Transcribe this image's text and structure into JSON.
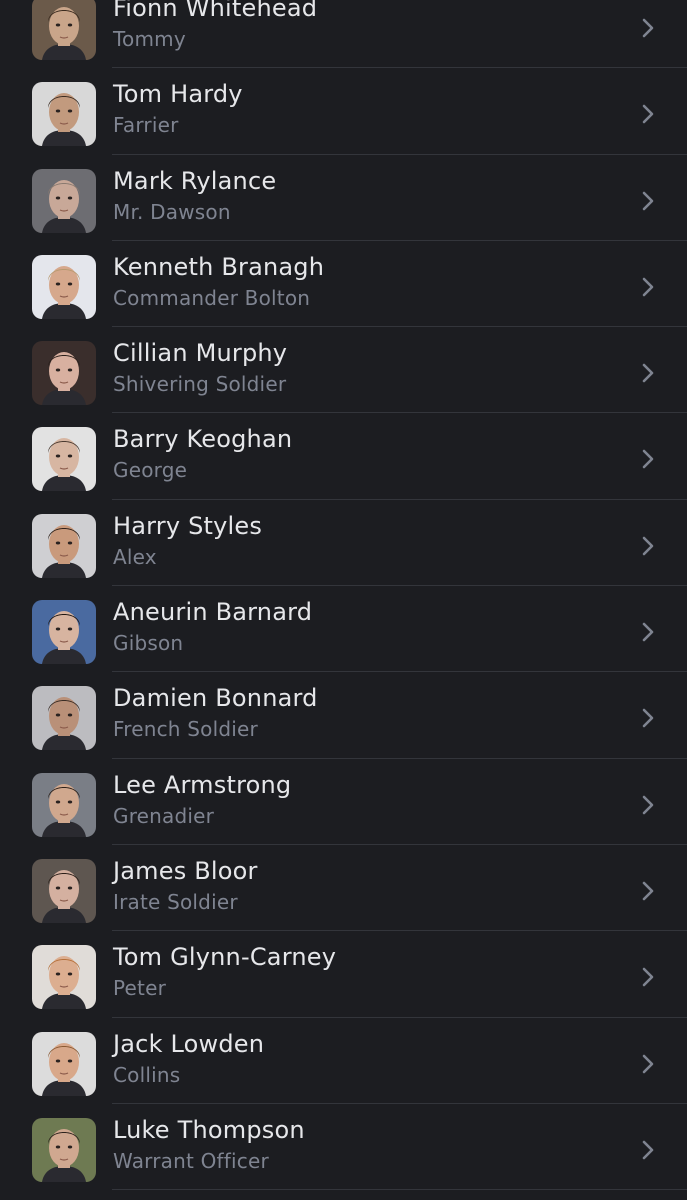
{
  "cast": [
    {
      "actor": "Fionn Whitehead",
      "character": "Tommy",
      "skin": "#c9a58a",
      "hair": "#3a2a1e",
      "bg": "#6b5a4a"
    },
    {
      "actor": "Tom Hardy",
      "character": "Farrier",
      "skin": "#c29a7e",
      "hair": "#3b2c22",
      "bg": "#d8d8d8"
    },
    {
      "actor": "Mark Rylance",
      "character": "Mr. Dawson",
      "skin": "#c8a898",
      "hair": "#8a7a70",
      "bg": "#6d6d72"
    },
    {
      "actor": "Kenneth Branagh",
      "character": "Commander Bolton",
      "skin": "#d6a88c",
      "hair": "#b89a70",
      "bg": "#e4e6ec"
    },
    {
      "actor": "Cillian Murphy",
      "character": "Shivering Soldier",
      "skin": "#d8b0a0",
      "hair": "#2a1f1a",
      "bg": "#3a2e2c"
    },
    {
      "actor": "Barry Keoghan",
      "character": "George",
      "skin": "#d7b6a2",
      "hair": "#4a3a30",
      "bg": "#e2e2e2"
    },
    {
      "actor": "Harry Styles",
      "character": "Alex",
      "skin": "#c99a7c",
      "hair": "#2e2018",
      "bg": "#cfcfd2"
    },
    {
      "actor": "Aneurin Barnard",
      "character": "Gibson",
      "skin": "#d7b4a0",
      "hair": "#1e1612",
      "bg": "#4a6aa0"
    },
    {
      "actor": "Damien Bonnard",
      "character": "French Soldier",
      "skin": "#b99078",
      "hair": "#3a2c24",
      "bg": "#bcbcc0"
    },
    {
      "actor": "Lee Armstrong",
      "character": "Grenadier",
      "skin": "#d0a88e",
      "hair": "#2c2018",
      "bg": "#7a7e86"
    },
    {
      "actor": "James Bloor",
      "character": "Irate Soldier",
      "skin": "#d4b0a0",
      "hair": "#2a1e18",
      "bg": "#5e5650"
    },
    {
      "actor": "Tom Glynn-Carney",
      "character": "Peter",
      "skin": "#dcae90",
      "hair": "#b5703a",
      "bg": "#e0dcd8"
    },
    {
      "actor": "Jack Lowden",
      "character": "Collins",
      "skin": "#d8a88a",
      "hair": "#8a5a34",
      "bg": "#dcdcdc"
    },
    {
      "actor": "Luke Thompson",
      "character": "Warrant Officer",
      "skin": "#d0a890",
      "hair": "#2c221c",
      "bg": "#6e7a52"
    }
  ],
  "colors": {
    "background": "#1c1d21",
    "actor_text": "#e6e7ea",
    "character_text": "#7f8491",
    "chevron": "#7f8491",
    "divider": "#33353b"
  }
}
